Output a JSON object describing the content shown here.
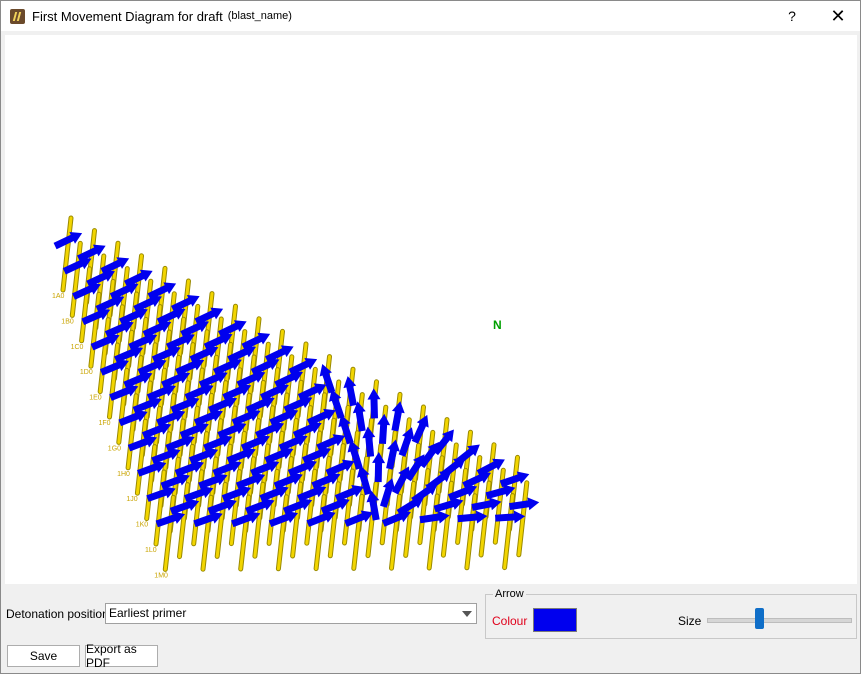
{
  "window": {
    "title": "First Movement Diagram for draft",
    "subtitle": "(blast_name)",
    "help_label": "?",
    "close_label": "✕",
    "icon": "app-logo-icon"
  },
  "diagram": {
    "north_label": "N",
    "hole_color": "#f2d500",
    "hole_outline": "#9a8a00",
    "arrow_color": "#0000ee",
    "hole_labels": [
      "1A0",
      "1B0",
      "1C0",
      "1D0",
      "1E0",
      "1F0",
      "1G0",
      "1H0",
      "1J0",
      "1K0",
      "1L0",
      "1M0"
    ]
  },
  "controls": {
    "detonation_label": "Detonation position",
    "detonation_value": "Earliest primer",
    "arrow_group_title": "Arrow",
    "colour_label": "Colour",
    "colour_value": "#0000ee",
    "size_label": "Size",
    "size_level": 0.37
  },
  "buttons": {
    "save_label": "Save",
    "export_label": "Export as PDF"
  }
}
